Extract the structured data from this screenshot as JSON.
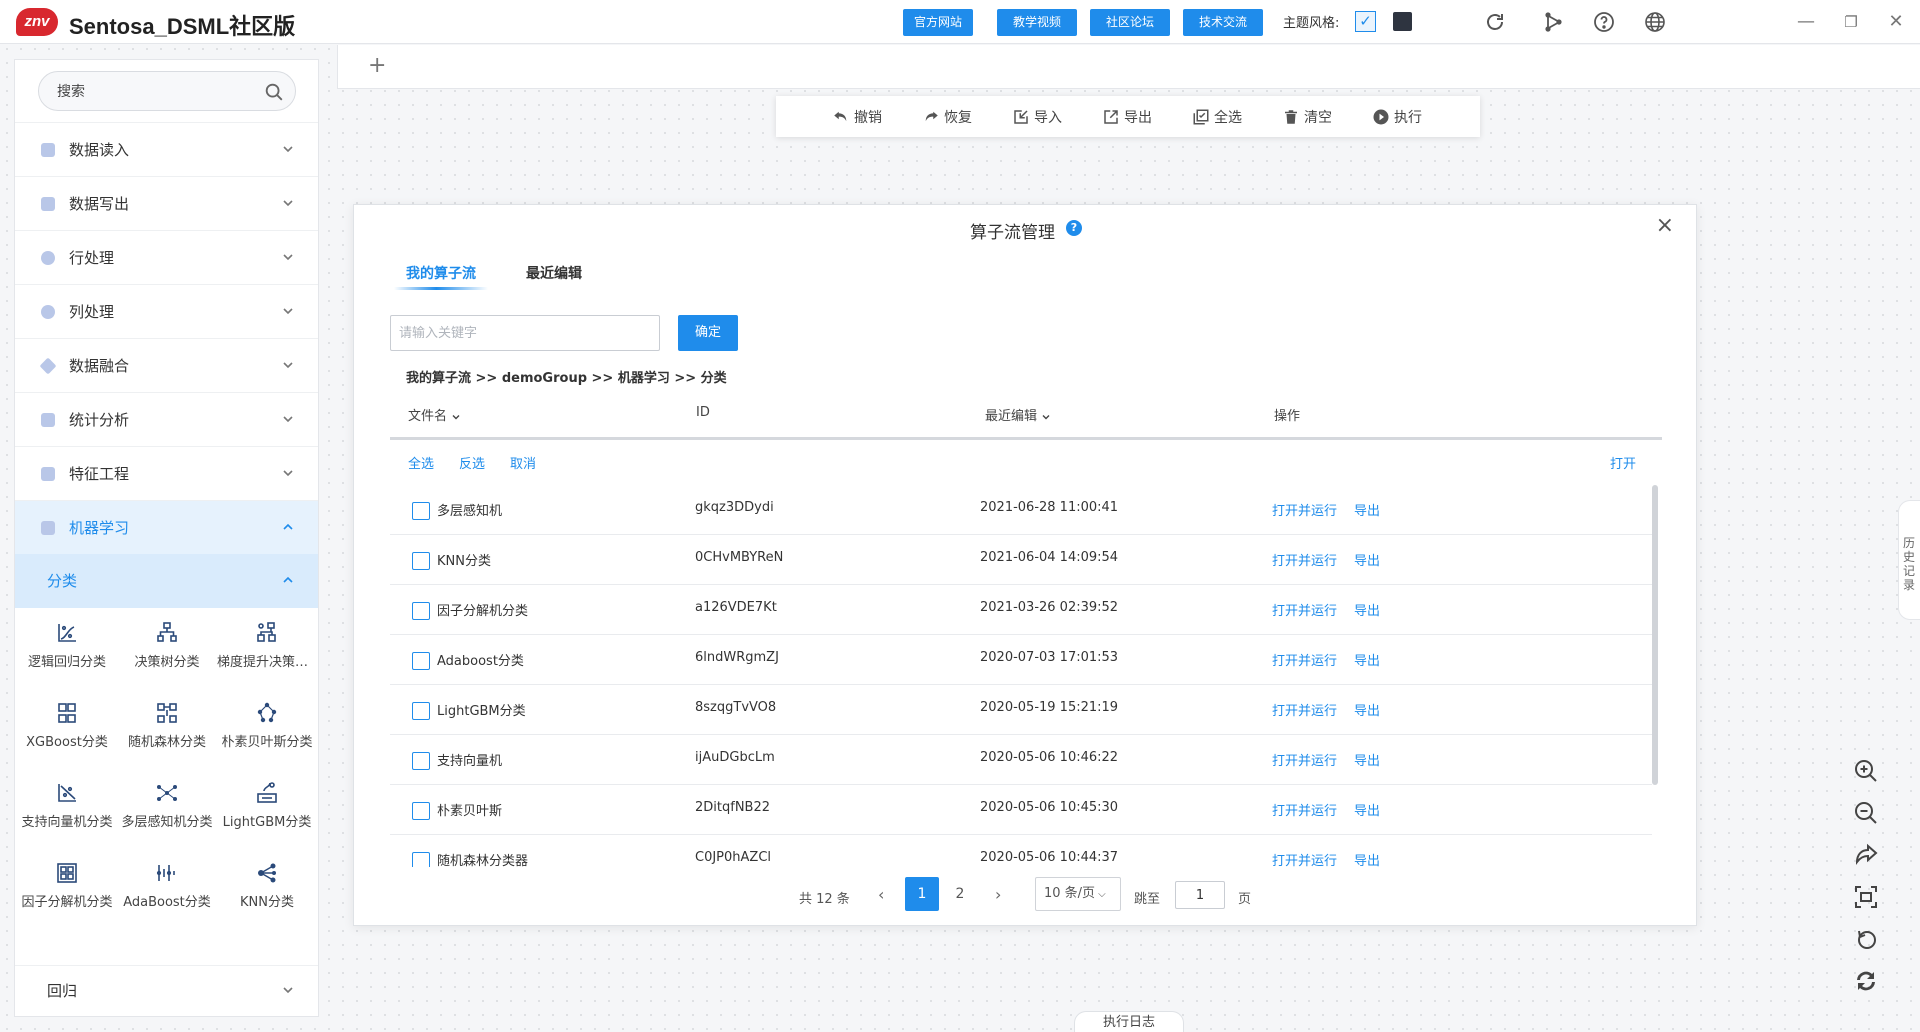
{
  "app": {
    "logo_text": "znv",
    "title": "Sentosa_DSML社区版",
    "links": [
      "官方网站",
      "教学视频",
      "社区论坛",
      "技术交流"
    ],
    "theme_label": "主题风格:",
    "theme_check": "✓"
  },
  "sidebar": {
    "search_placeholder": "搜索",
    "categories": [
      {
        "label": "数据读入"
      },
      {
        "label": "数据写出"
      },
      {
        "label": "行处理"
      },
      {
        "label": "列处理"
      },
      {
        "label": "数据融合"
      },
      {
        "label": "统计分析"
      },
      {
        "label": "特征工程"
      },
      {
        "label": "机器学习"
      }
    ],
    "subcategory": "分类",
    "algorithms": [
      {
        "label": "逻辑回归分类",
        "icon": "logistic-icon"
      },
      {
        "label": "决策树分类",
        "icon": "tree-icon"
      },
      {
        "label": "梯度提升决策树分类",
        "icon": "gbdt-icon"
      },
      {
        "label": "XGBoost分类",
        "icon": "xgboost-icon"
      },
      {
        "label": "随机森林分类",
        "icon": "forest-icon"
      },
      {
        "label": "朴素贝叶斯分类",
        "icon": "bayes-icon"
      },
      {
        "label": "支持向量机分类",
        "icon": "svm-icon"
      },
      {
        "label": "多层感知机分类",
        "icon": "mlp-icon"
      },
      {
        "label": "LightGBM分类",
        "icon": "lightgbm-icon"
      },
      {
        "label": "因子分解机分类",
        "icon": "fm-icon"
      },
      {
        "label": "AdaBoost分类",
        "icon": "adaboost-icon"
      },
      {
        "label": "KNN分类",
        "icon": "knn-icon"
      }
    ],
    "regression": "回归"
  },
  "tabbar": {
    "add": "+"
  },
  "toolbar": {
    "items": [
      {
        "label": "撤销",
        "icon": "undo-icon"
      },
      {
        "label": "恢复",
        "icon": "redo-icon"
      },
      {
        "label": "导入",
        "icon": "import-icon"
      },
      {
        "label": "导出",
        "icon": "export-icon"
      },
      {
        "label": "全选",
        "icon": "select-all-icon"
      },
      {
        "label": "清空",
        "icon": "trash-icon"
      },
      {
        "label": "执行",
        "icon": "play-icon"
      }
    ]
  },
  "dialog": {
    "title": "算子流管理",
    "help": "?",
    "close": "×",
    "tabs": [
      "我的算子流",
      "最近编辑"
    ],
    "keyword_placeholder": "请输入关键字",
    "confirm": "确定",
    "breadcrumb": "我的算子流 >> demoGroup >> 机器学习 >> 分类",
    "headers": {
      "name": "文件名",
      "id": "ID",
      "edited": "最近编辑",
      "ops": "操作"
    },
    "selection": {
      "all": "全选",
      "invert": "反选",
      "cancel": "取消",
      "open": "打开"
    },
    "rows": [
      {
        "name": "多层感知机",
        "id": "gkqz3DDydi",
        "edited": "2021-06-28 11:00:41"
      },
      {
        "name": "KNN分类",
        "id": "0CHvMBYReN",
        "edited": "2021-06-04 14:09:54"
      },
      {
        "name": "因子分解机分类",
        "id": "a126VDE7Kt",
        "edited": "2021-03-26 02:39:52"
      },
      {
        "name": "Adaboost分类",
        "id": "6lndWRgmZJ",
        "edited": "2020-07-03 17:01:53"
      },
      {
        "name": "LightGBM分类",
        "id": "8szqgTvVO8",
        "edited": "2020-05-19 15:21:19"
      },
      {
        "name": "支持向量机",
        "id": "ijAuDGbcLm",
        "edited": "2020-05-06 10:46:22"
      },
      {
        "name": "朴素贝叶斯",
        "id": "2DitqfNB22",
        "edited": "2020-05-06 10:45:30"
      },
      {
        "name": "随机森林分类器",
        "id": "C0JP0hAZCl",
        "edited": "2020-05-06 10:44:37"
      }
    ],
    "row_actions": {
      "run": "打开并运行",
      "export": "导出"
    },
    "pager": {
      "total": "共 12 条",
      "prev": "‹",
      "pages": [
        "1",
        "2"
      ],
      "next": "›",
      "size": "10 条/页",
      "jump_label": "跳至",
      "jump_value": "1",
      "suffix": "页"
    }
  },
  "history_tab": "历史记录",
  "log_tab": "执行日志",
  "colors": {
    "accent": "#1f8ceb",
    "logo": "#d8282f"
  }
}
